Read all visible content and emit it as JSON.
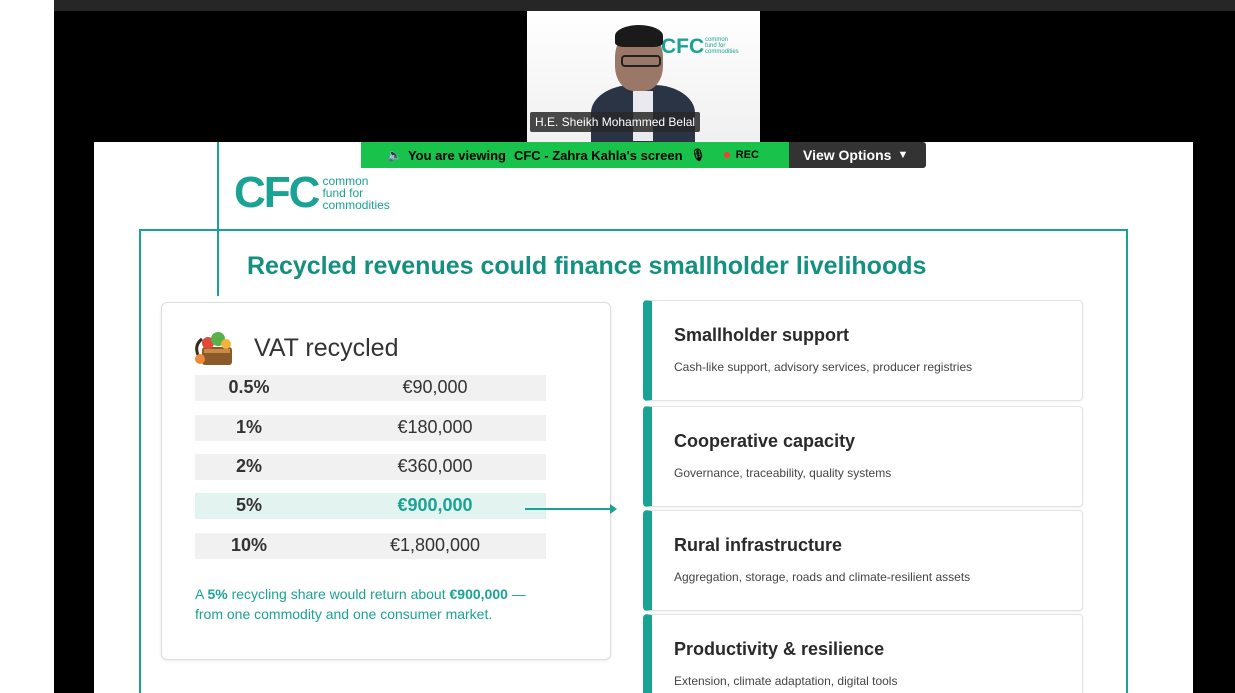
{
  "video": {
    "participant_name": "H.E. Sheikh Mohammed Belal",
    "background_logo": "CFC",
    "background_logo_sub": [
      "common",
      "fund for",
      "commodities"
    ]
  },
  "share_banner": {
    "viewing_label": "You are viewing",
    "screen_owner": "CFC - Zahra Kahla's screen",
    "rec_label": "REC",
    "view_options_label": "View Options",
    "icons": [
      "speaker-icon",
      "mic-muted-icon",
      "rec-dot-icon",
      "chevron-down-icon"
    ],
    "color": "#19c24b"
  },
  "slide": {
    "logo_big": "CFC",
    "logo_small": [
      "common",
      "fund for",
      "commodities"
    ],
    "title": "Recycled revenues could finance smallholder livelihoods",
    "accent_color": "#1aa394",
    "vat": {
      "title": "VAT recycled",
      "rows": [
        {
          "pct": "0.5%",
          "amount": "€90,000"
        },
        {
          "pct": "1%",
          "amount": "€180,000"
        },
        {
          "pct": "2%",
          "amount": "€360,000"
        },
        {
          "pct": "5%",
          "amount": "€900,000"
        },
        {
          "pct": "10%",
          "amount": "€1,800,000"
        }
      ],
      "note_prefix": "A ",
      "note_pct": "5%",
      "note_mid": " recycling share would return about ",
      "note_amount": "€900,000",
      "note_suffix": " — from one commodity and one consumer market."
    },
    "cards": [
      {
        "title": "Smallholder support",
        "desc": "Cash-like support, advisory services, producer registries"
      },
      {
        "title": "Cooperative capacity",
        "desc": "Governance, traceability, quality systems"
      },
      {
        "title": "Rural infrastructure",
        "desc": "Aggregation, storage, roads and climate-resilient assets"
      },
      {
        "title": "Productivity & resilience",
        "desc": "Extension, climate adaptation, digital tools"
      }
    ]
  }
}
